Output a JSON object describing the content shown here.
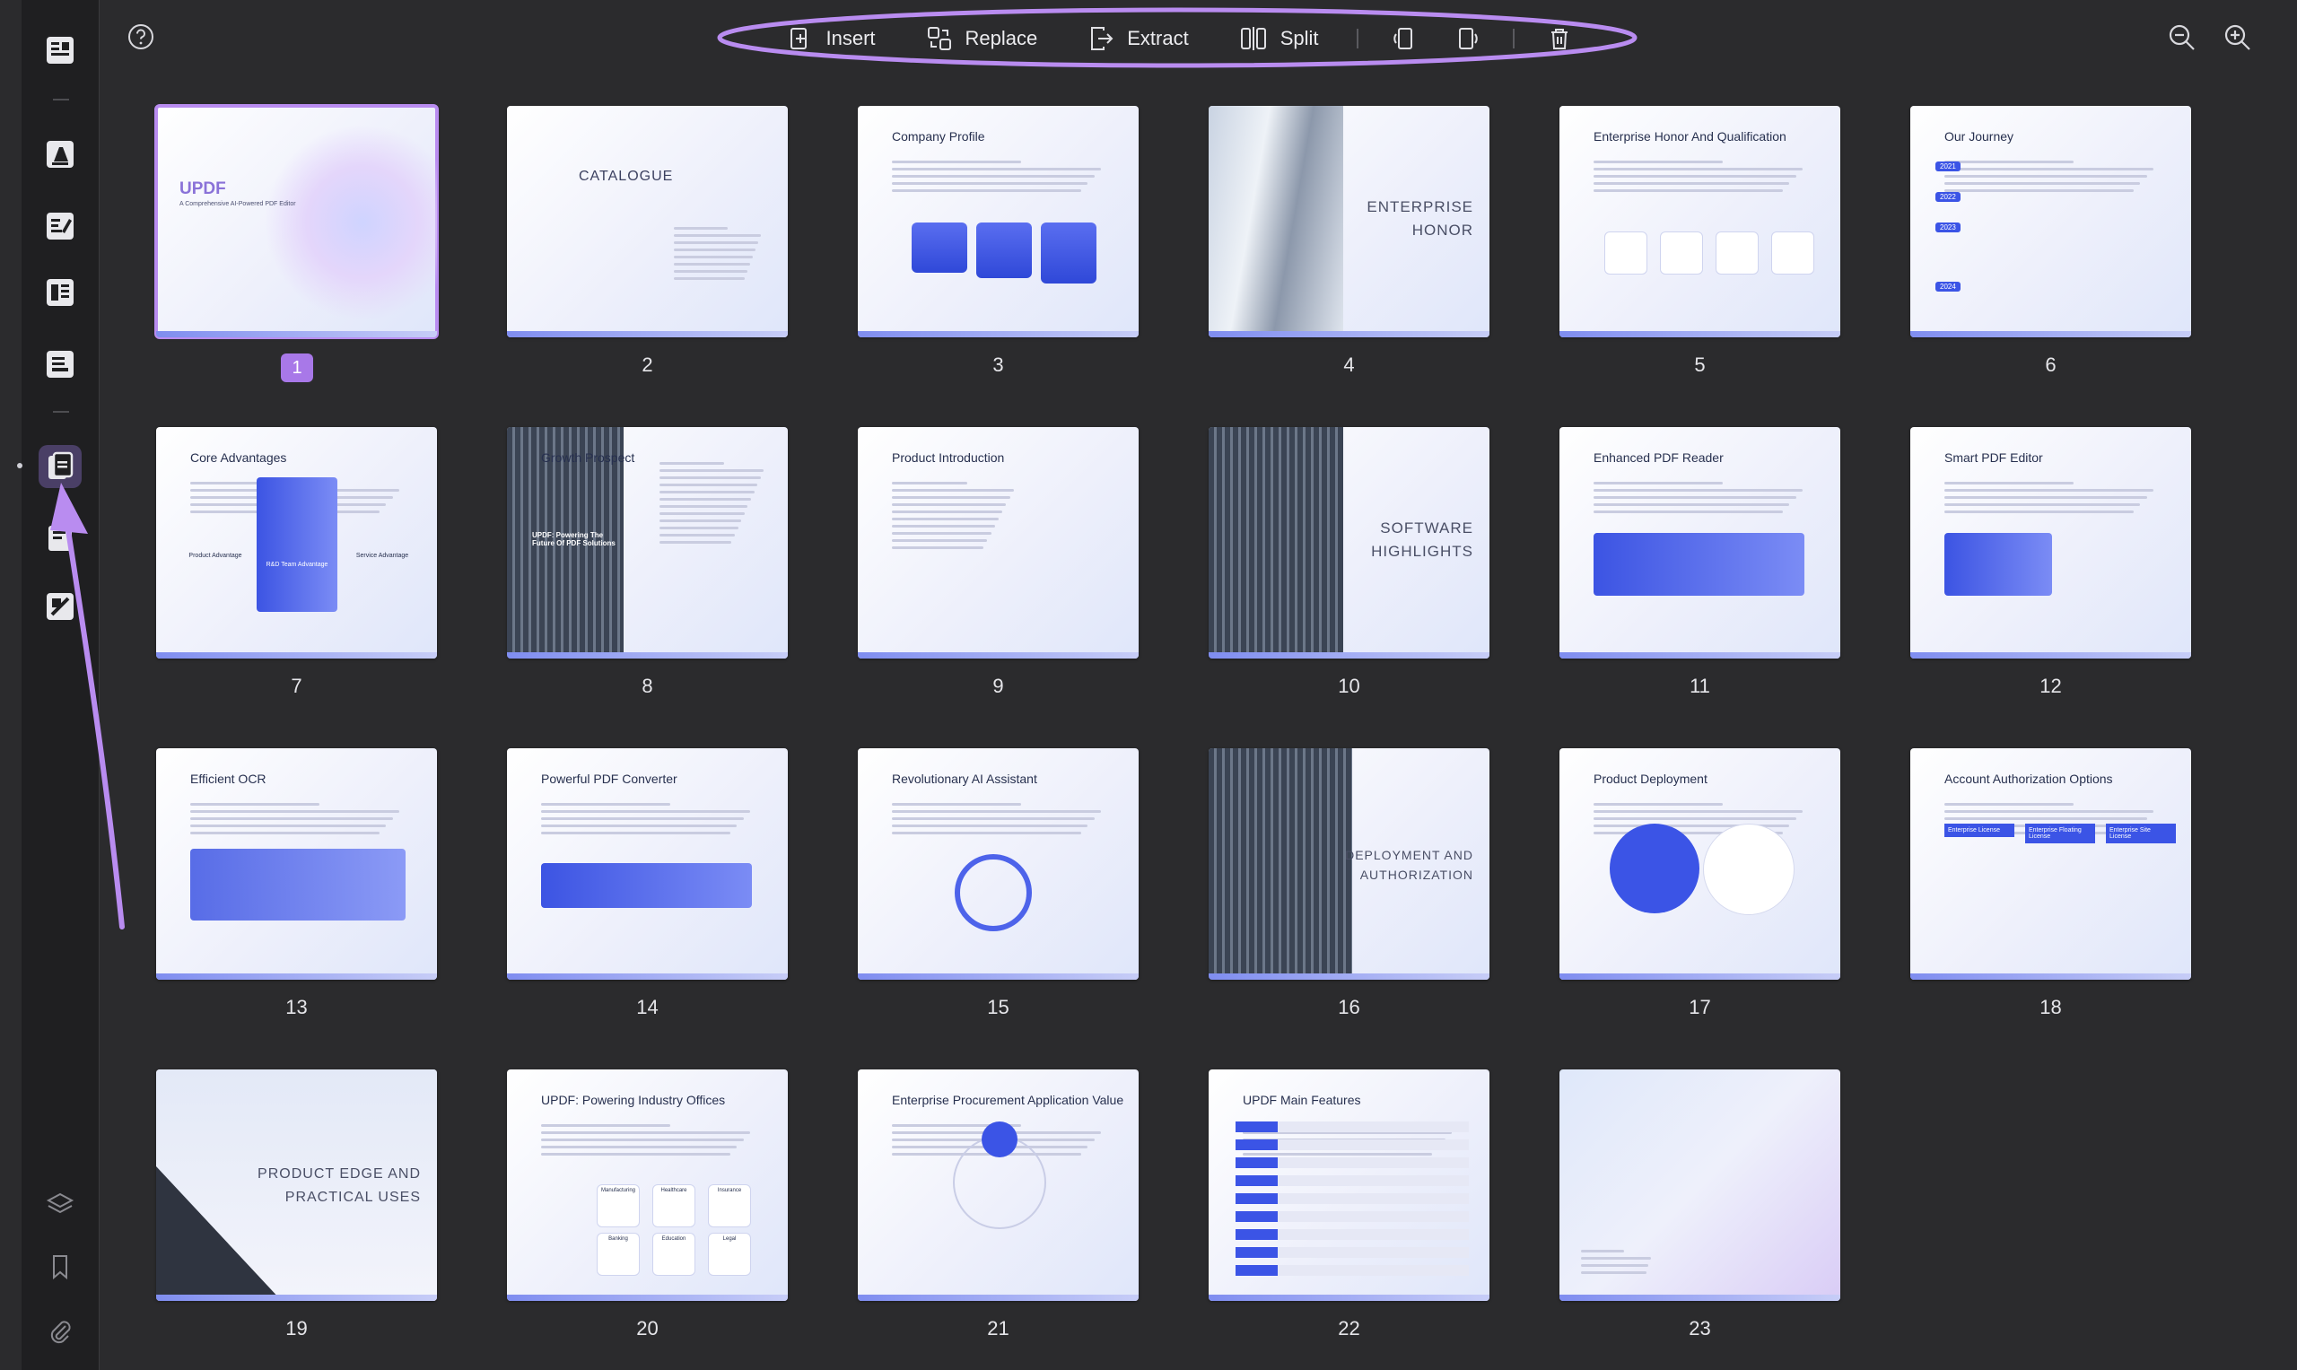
{
  "toolbar": {
    "insert_label": "Insert",
    "replace_label": "Replace",
    "extract_label": "Extract",
    "split_label": "Split"
  },
  "rail": {
    "icons": [
      "reader-icon",
      "comment-icon",
      "edit-icon",
      "form-icon",
      "convert-icon",
      "organize-pages-icon",
      "fill-sign-icon",
      "protect-icon",
      "layers-icon",
      "bookmark-icon",
      "attachment-icon"
    ]
  },
  "colors": {
    "accent": "#a878e8",
    "annotation": "#b98cf0",
    "background": "#2b2b2d"
  },
  "pages": [
    {
      "num": "1",
      "title": "UPDF",
      "subtitle": "A Comprehensive AI-Powered PDF Editor",
      "selected": true
    },
    {
      "num": "2",
      "title": "CATALOGUE"
    },
    {
      "num": "3",
      "title": "Company Profile"
    },
    {
      "num": "4",
      "title": "ENTERPRISE",
      "title2": "HONOR"
    },
    {
      "num": "5",
      "title": "Enterprise Honor And Qualification"
    },
    {
      "num": "6",
      "title": "Our Journey",
      "years": [
        "2021",
        "2022",
        "2023",
        "2024"
      ]
    },
    {
      "num": "7",
      "title": "Core Advantages",
      "items": [
        "Product Advantage",
        "R&D Team Advantage",
        "Service Advantage"
      ]
    },
    {
      "num": "8",
      "title": "Growth Prospect",
      "caption": "UPDF: Powering The Future Of PDF Solutions"
    },
    {
      "num": "9",
      "title": "Product Introduction"
    },
    {
      "num": "10",
      "title": "SOFTWARE",
      "title2": "HIGHLIGHTS"
    },
    {
      "num": "11",
      "title": "Enhanced PDF Reader"
    },
    {
      "num": "12",
      "title": "Smart PDF Editor"
    },
    {
      "num": "13",
      "title": "Efficient OCR"
    },
    {
      "num": "14",
      "title": "Powerful PDF Converter"
    },
    {
      "num": "15",
      "title": "Revolutionary AI Assistant"
    },
    {
      "num": "16",
      "title": "DEPLOYMENT AND",
      "title2": "AUTHORIZATION"
    },
    {
      "num": "17",
      "title": "Product Deployment"
    },
    {
      "num": "18",
      "title": "Account Authorization Options",
      "items": [
        "Enterprise License",
        "Enterprise Floating License",
        "Enterprise Site License"
      ]
    },
    {
      "num": "19",
      "title": "PRODUCT EDGE AND",
      "title2": "PRACTICAL USES"
    },
    {
      "num": "20",
      "title": "UPDF: Powering Industry Offices",
      "items": [
        "Manufacturing",
        "Healthcare",
        "Insurance",
        "Banking",
        "Education",
        "Legal"
      ]
    },
    {
      "num": "21",
      "title": "Enterprise Procurement Application Value"
    },
    {
      "num": "22",
      "title": "UPDF Main Features"
    },
    {
      "num": "23",
      "title": ""
    }
  ]
}
